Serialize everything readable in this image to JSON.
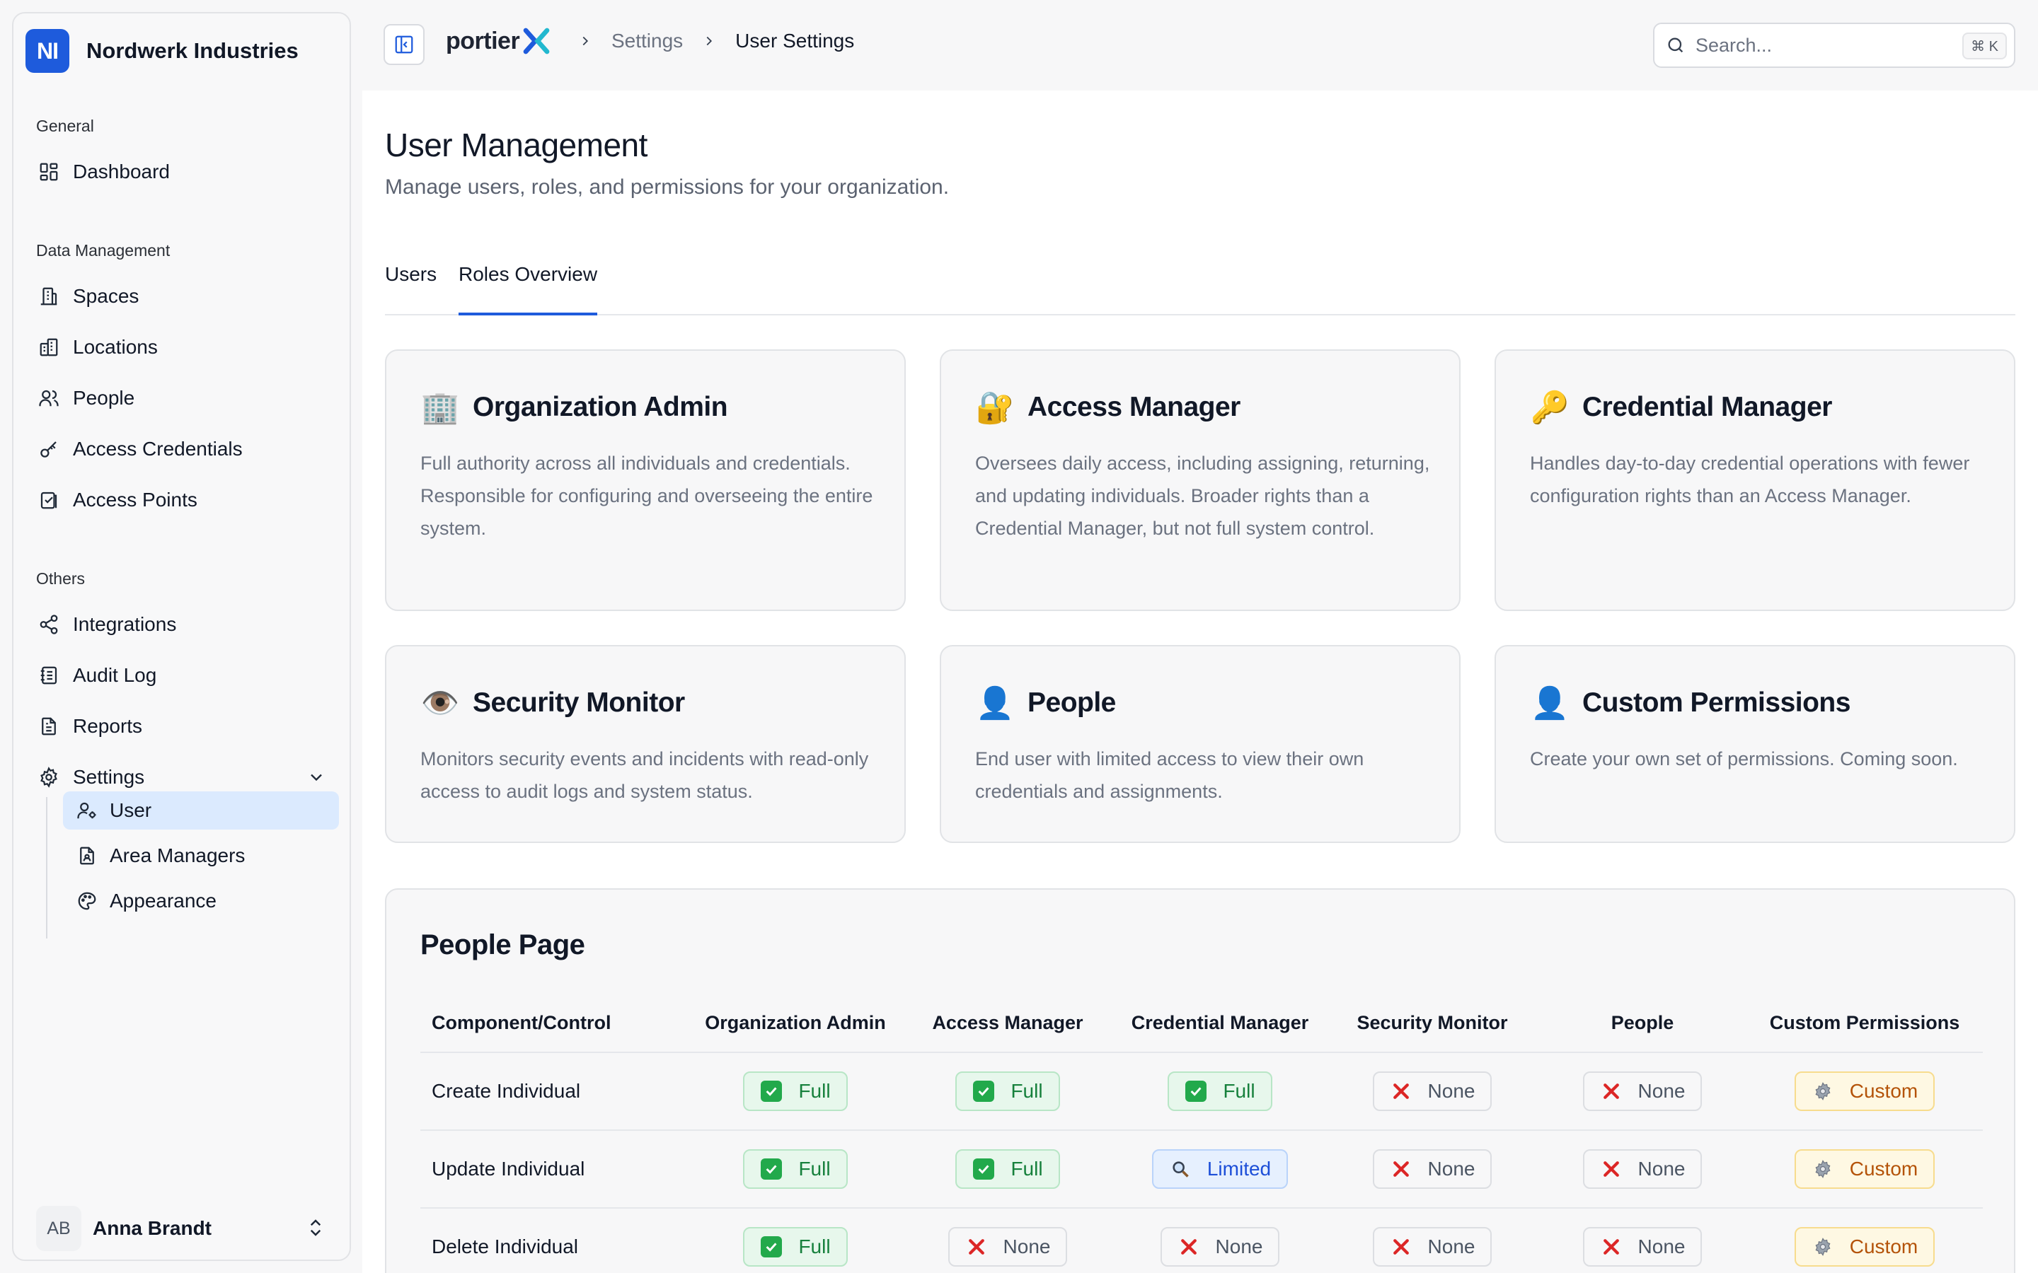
{
  "org": {
    "initials": "NI",
    "name": "Nordwerk Industries"
  },
  "sidebar": {
    "sections": [
      {
        "label": "General"
      },
      {
        "label": "Data Management"
      },
      {
        "label": "Others"
      }
    ],
    "items": {
      "dashboard": "Dashboard",
      "spaces": "Spaces",
      "locations": "Locations",
      "people": "People",
      "access_credentials": "Access Credentials",
      "access_points": "Access Points",
      "integrations": "Integrations",
      "audit_log": "Audit Log",
      "reports": "Reports",
      "settings": "Settings"
    },
    "settings_sub": {
      "user": "User",
      "area_managers": "Area Managers",
      "appearance": "Appearance"
    },
    "user": {
      "initials": "AB",
      "name": "Anna Brandt"
    }
  },
  "topbar": {
    "brand": "portier",
    "breadcrumbs": [
      "Settings",
      "User Settings"
    ],
    "search_placeholder": "Search...",
    "search_shortcut": "⌘ K"
  },
  "main": {
    "title": "User Management",
    "subtitle": "Manage users, roles, and permissions for your organization.",
    "tabs": [
      "Users",
      "Roles Overview"
    ],
    "active_tab": "Roles Overview"
  },
  "roles": [
    {
      "icon": "🏢",
      "icon_name": "office-building-icon",
      "title": "Organization Admin",
      "desc": "Full authority across all individuals and credentials. Responsible for configuring and overseeing the entire system."
    },
    {
      "icon": "🔐",
      "icon_name": "lock-key-icon",
      "title": "Access Manager",
      "desc": "Oversees daily access, including assigning, returning, and updating individuals. Broader rights than a Credential Manager, but not full system control."
    },
    {
      "icon": "🔑",
      "icon_name": "key-icon",
      "title": "Credential Manager",
      "desc": "Handles day-to-day credential operations with fewer configuration rights than an Access Manager."
    },
    {
      "icon": "👁️",
      "icon_name": "eye-icon",
      "title": "Security Monitor",
      "desc": "Monitors security events and incidents with read-only access to audit logs and system status."
    },
    {
      "icon": "👤",
      "icon_name": "person-icon",
      "title": "People",
      "desc": "End user with limited access to view their own credentials and assignments."
    },
    {
      "icon": "👤",
      "icon_name": "person-icon",
      "title": "Custom Permissions",
      "desc": "Create your own set of permissions. Coming soon."
    }
  ],
  "permissions": {
    "title": "People Page",
    "headers": [
      "Component/Control",
      "Organization Admin",
      "Access Manager",
      "Credential Manager",
      "Security Monitor",
      "People",
      "Custom Permissions"
    ],
    "rows": [
      {
        "label": "Create Individual",
        "cells": [
          {
            "level": "full",
            "text": "Full"
          },
          {
            "level": "full",
            "text": "Full"
          },
          {
            "level": "full",
            "text": "Full"
          },
          {
            "level": "none",
            "text": "None"
          },
          {
            "level": "none",
            "text": "None"
          },
          {
            "level": "custom",
            "text": "Custom"
          }
        ]
      },
      {
        "label": "Update Individual",
        "cells": [
          {
            "level": "full",
            "text": "Full"
          },
          {
            "level": "full",
            "text": "Full"
          },
          {
            "level": "limited",
            "text": "Limited"
          },
          {
            "level": "none",
            "text": "None"
          },
          {
            "level": "none",
            "text": "None"
          },
          {
            "level": "custom",
            "text": "Custom"
          }
        ]
      },
      {
        "label": "Delete Individual",
        "cells": [
          {
            "level": "full",
            "text": "Full"
          },
          {
            "level": "none",
            "text": "None"
          },
          {
            "level": "none",
            "text": "None"
          },
          {
            "level": "none",
            "text": "None"
          },
          {
            "level": "none",
            "text": "None"
          },
          {
            "level": "custom",
            "text": "Custom"
          }
        ]
      }
    ]
  },
  "colors": {
    "accent": "#1e5bdc",
    "full": "#16803c",
    "limited": "#1d4fd8",
    "custom": "#b45309",
    "none_icon": "#dc2626"
  }
}
